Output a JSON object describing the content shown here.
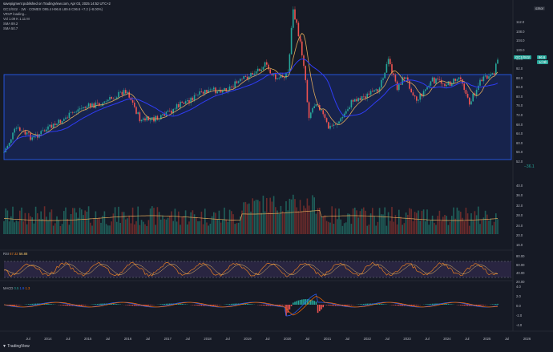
{
  "header": {
    "published": "savepigment published on TradingView.com, Apr 03, 2025 14:52 UTC+2",
    "symbol_line": "GC1!/SI1! · 1W · COMEX  O95.4 H96.6 L89.6 C96.6  +7.2 (+8.00%)",
    "vrvp": "VRVP loading...",
    "vol": "Vol  1.09 K  1.11 M",
    "sma1": "SMA  89.2",
    "sma2": "SMA  50.7"
  },
  "currency_button": "ozsor",
  "price_axis": {
    "ticks": [
      "112.0",
      "108.0",
      "104.0",
      "100.0",
      "96.0",
      "92.0",
      "88.0",
      "84.0",
      "80.0",
      "76.0",
      "72.0",
      "68.0",
      "64.0",
      "60.0",
      "56.0",
      "52.0"
    ],
    "current_label": "GC1!/SI1!",
    "current_value": "96.6",
    "countdown": "1d 9h",
    "range_label": "−36.1"
  },
  "volume_axis": {
    "ticks": [
      "40.0",
      "36.0",
      "32.0",
      "28.0",
      "24.0",
      "20.0",
      "16.0"
    ]
  },
  "rsi": {
    "label": "RSI",
    "v1": "67.32",
    "v2": "56.88",
    "ticks": [
      "80.00",
      "60.00",
      "40.00",
      "20.00"
    ]
  },
  "macd": {
    "label": "MACD",
    "v1": "0.5",
    "v2": "1.9",
    "v3": "1.3",
    "ticks": [
      "4.0",
      "2.0",
      "0.0",
      "-2.0",
      "-4.0"
    ]
  },
  "time_axis": [
    "Jul",
    "2014",
    "Jul",
    "2015",
    "Jul",
    "2016",
    "Jul",
    "2017",
    "Jul",
    "2018",
    "Jul",
    "2019",
    "Jul",
    "2020",
    "Jul",
    "2021",
    "Jul",
    "2022",
    "Jul",
    "2023",
    "Jul",
    "2024",
    "Jul",
    "2025",
    "Jul",
    "2026"
  ],
  "brand": "TradingView",
  "colors": {
    "up": "#26a69a",
    "down": "#ef5350",
    "sma_fast": "#e0a95a",
    "sma_slow": "#2f3cf5",
    "box": "#2962ff",
    "bg": "#161a25",
    "rsi": "#e67e22",
    "macd_line": "#2962ff",
    "signal_line": "#ff6d00"
  }
}
